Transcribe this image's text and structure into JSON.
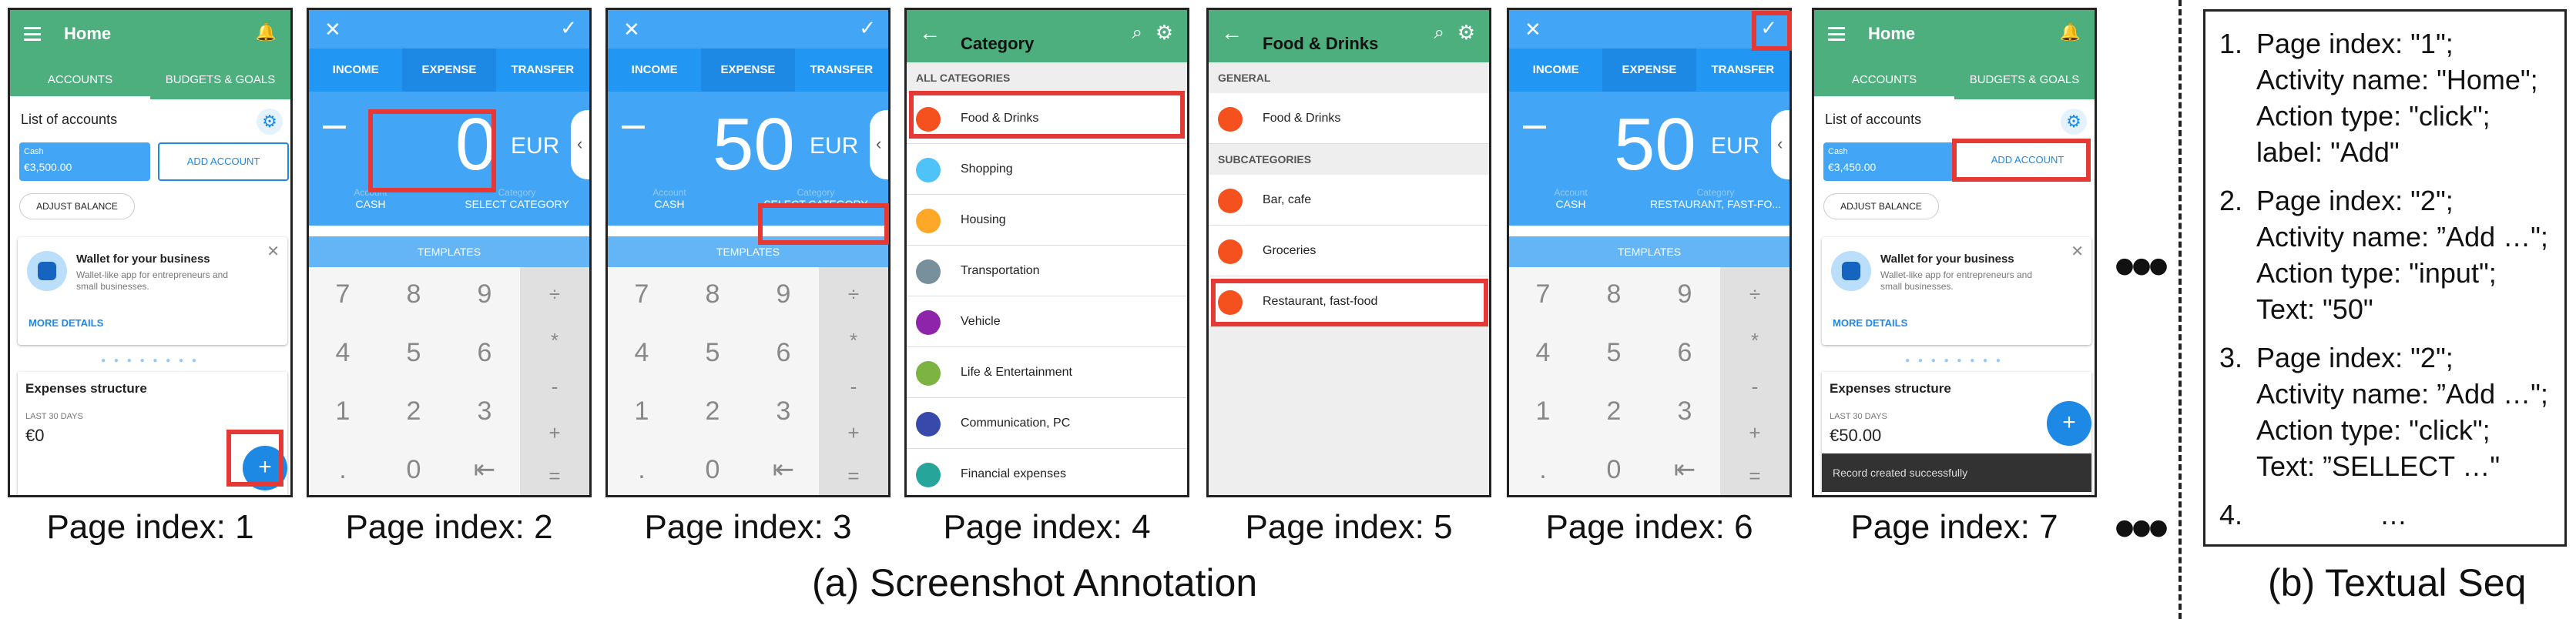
{
  "pages": [
    {
      "index_label": "Page index: 1"
    },
    {
      "index_label": "Page index: 2"
    },
    {
      "index_label": "Page index: 3"
    },
    {
      "index_label": "Page index: 4"
    },
    {
      "index_label": "Page index: 5"
    },
    {
      "index_label": "Page index: 6"
    },
    {
      "index_label": "Page index: 7"
    }
  ],
  "home": {
    "title": "Home",
    "tab_accounts": "ACCOUNTS",
    "tab_budgets": "BUDGETS & GOALS",
    "list_title": "List of accounts",
    "cash_label": "Cash",
    "cash_value_p1": "€3,500.00",
    "cash_value_p7": "€3,450.00",
    "add_account": "ADD ACCOUNT",
    "adjust_balance": "ADJUST BALANCE",
    "wallet_title": "Wallet for your business",
    "wallet_sub": "Wallet-like app for entrepreneurs and small businesses.",
    "more_details": "MORE DETAILS",
    "exp_title": "Expenses structure",
    "exp_period": "LAST 30 DAYS",
    "exp_value_p1": "€0",
    "exp_value_p7": "€50.00",
    "fab": "+",
    "toast": "Record created successfully"
  },
  "expense": {
    "income": "INCOME",
    "expense": "EXPENSE",
    "transfer": "TRANSFER",
    "amount_p2": "0",
    "amount_p3": "50",
    "amount_p6": "50",
    "currency": "EUR",
    "account_lbl": "Account",
    "account_val": "CASH",
    "category_lbl": "Category",
    "category_val": "SELECT CATEGORY",
    "category_val_p6": "RESTAURANT, FAST-FO...",
    "templates": "TEMPLATES",
    "keys": [
      "7",
      "8",
      "9",
      "4",
      "5",
      "6",
      "1",
      "2",
      "3",
      ".",
      "0",
      "⇤"
    ],
    "ops": [
      "÷",
      "*",
      "-",
      "+",
      "="
    ]
  },
  "category": {
    "title": "Category",
    "section": "ALL CATEGORIES",
    "items": [
      {
        "label": "Food & Drinks",
        "color": "#f4511e"
      },
      {
        "label": "Shopping",
        "color": "#4fc3f7"
      },
      {
        "label": "Housing",
        "color": "#ffa726"
      },
      {
        "label": "Transportation",
        "color": "#78909c"
      },
      {
        "label": "Vehicle",
        "color": "#8e24aa"
      },
      {
        "label": "Life & Entertainment",
        "color": "#7cb342"
      },
      {
        "label": "Communication, PC",
        "color": "#3949ab"
      },
      {
        "label": "Financial expenses",
        "color": "#26a69a"
      }
    ]
  },
  "food": {
    "title": "Food & Drinks",
    "general": "GENERAL",
    "general_item": "Food & Drinks",
    "sub": "SUBCATEGORIES",
    "items": [
      "Bar, cafe",
      "Groceries",
      "Restaurant, fast-food"
    ]
  },
  "ellipsis": "•••",
  "captions": {
    "a": "(a) Screenshot Annotation",
    "b": "(b) Textual Seq"
  },
  "seq": [
    {
      "n": "1.",
      "lines": [
        "Page index: \"1\";",
        "Activity name: \"Home\";",
        "Action type: \"click\";",
        "label: \"Add\""
      ]
    },
    {
      "n": "2.",
      "lines": [
        "Page index: \"2\";",
        "Activity name: ”Add …\";",
        "Action type: \"input\";",
        "Text: \"50\""
      ]
    },
    {
      "n": "3.",
      "lines": [
        "Page index: \"2\";",
        "Activity name: ”Add …\";",
        "Action type: \"click\";",
        "Text: ”SELLECT …\""
      ]
    },
    {
      "n": "4.",
      "lines": [
        "…"
      ]
    }
  ]
}
